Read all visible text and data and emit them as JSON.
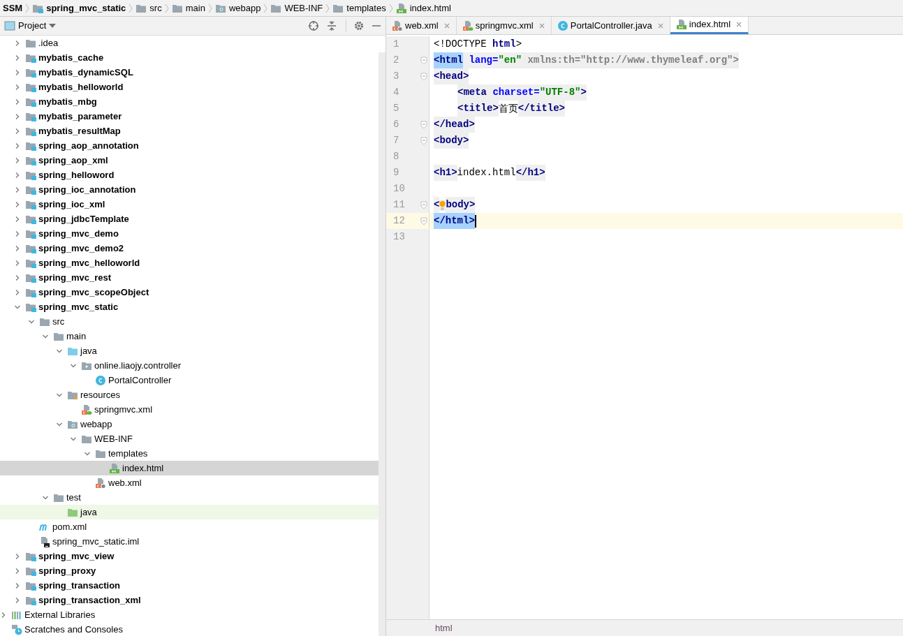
{
  "breadcrumbs": [
    {
      "label": "SSM",
      "kind": "project"
    },
    {
      "label": "spring_mvc_static",
      "kind": "module"
    },
    {
      "label": "src",
      "kind": "folder"
    },
    {
      "label": "main",
      "kind": "folder"
    },
    {
      "label": "webapp",
      "kind": "web-folder"
    },
    {
      "label": "WEB-INF",
      "kind": "folder"
    },
    {
      "label": "templates",
      "kind": "folder"
    },
    {
      "label": "index.html",
      "kind": "html"
    }
  ],
  "project_panel": {
    "title": "Project"
  },
  "tree": [
    {
      "label": ".idea",
      "kind": "folder",
      "expanded": false,
      "selected": false
    },
    {
      "label": "mybatis_cache",
      "kind": "module",
      "expanded": false,
      "selected": false
    },
    {
      "label": "mybatis_dynamicSQL",
      "kind": "module",
      "expanded": false,
      "selected": false
    },
    {
      "label": "mybatis_helloworld",
      "kind": "module",
      "expanded": false,
      "selected": false
    },
    {
      "label": "mybatis_mbg",
      "kind": "module",
      "expanded": false,
      "selected": false
    },
    {
      "label": "mybatis_parameter",
      "kind": "module",
      "expanded": false,
      "selected": false
    },
    {
      "label": "mybatis_resultMap",
      "kind": "module",
      "expanded": false,
      "selected": false
    },
    {
      "label": "spring_aop_annotation",
      "kind": "module",
      "expanded": false,
      "selected": false
    },
    {
      "label": "spring_aop_xml",
      "kind": "module",
      "expanded": false,
      "selected": false
    },
    {
      "label": "spring_helloword",
      "kind": "module",
      "expanded": false,
      "selected": false
    },
    {
      "label": "spring_ioc_annotation",
      "kind": "module",
      "expanded": false,
      "selected": false
    },
    {
      "label": "spring_ioc_xml",
      "kind": "module",
      "expanded": false,
      "selected": false
    },
    {
      "label": "spring_jdbcTemplate",
      "kind": "module",
      "expanded": false,
      "selected": false
    },
    {
      "label": "spring_mvc_demo",
      "kind": "module",
      "expanded": false,
      "selected": false
    },
    {
      "label": "spring_mvc_demo2",
      "kind": "module",
      "expanded": false,
      "selected": false
    },
    {
      "label": "spring_mvc_helloworld",
      "kind": "module",
      "expanded": false,
      "selected": false
    },
    {
      "label": "spring_mvc_rest",
      "kind": "module",
      "expanded": false,
      "selected": false
    },
    {
      "label": "spring_mvc_scopeObject",
      "kind": "module",
      "expanded": false,
      "selected": false
    },
    {
      "label": "spring_mvc_static",
      "kind": "module",
      "expanded": true,
      "selected": false,
      "children": [
        {
          "label": "src",
          "kind": "folder",
          "expanded": true,
          "selected": false,
          "children": [
            {
              "label": "main",
              "kind": "folder",
              "expanded": true,
              "selected": false,
              "children": [
                {
                  "label": "java",
                  "kind": "source-folder",
                  "expanded": true,
                  "selected": false,
                  "children": [
                    {
                      "label": "online.liaojy.controller",
                      "kind": "package",
                      "expanded": true,
                      "selected": false,
                      "children": [
                        {
                          "label": "PortalController",
                          "kind": "class",
                          "selected": false
                        }
                      ]
                    }
                  ]
                },
                {
                  "label": "resources",
                  "kind": "resources-folder",
                  "expanded": true,
                  "selected": false,
                  "children": [
                    {
                      "label": "springmvc.xml",
                      "kind": "spring-xml",
                      "selected": false
                    }
                  ]
                },
                {
                  "label": "webapp",
                  "kind": "web-folder",
                  "expanded": true,
                  "selected": false,
                  "children": [
                    {
                      "label": "WEB-INF",
                      "kind": "folder",
                      "expanded": true,
                      "selected": false,
                      "children": [
                        {
                          "label": "templates",
                          "kind": "folder",
                          "expanded": true,
                          "selected": false,
                          "children": [
                            {
                              "label": "index.html",
                              "kind": "html",
                              "selected": true
                            }
                          ]
                        },
                        {
                          "label": "web.xml",
                          "kind": "web-xml",
                          "selected": false
                        }
                      ]
                    }
                  ]
                }
              ]
            },
            {
              "label": "test",
              "kind": "folder",
              "expanded": true,
              "selected": false,
              "children": [
                {
                  "label": "java",
                  "kind": "test-folder",
                  "selected": false
                }
              ]
            }
          ]
        },
        {
          "label": "pom.xml",
          "kind": "maven",
          "selected": false
        },
        {
          "label": "spring_mvc_static.iml",
          "kind": "iml",
          "selected": false
        }
      ]
    },
    {
      "label": "spring_mvc_view",
      "kind": "module",
      "expanded": false,
      "selected": false
    },
    {
      "label": "spring_proxy",
      "kind": "module",
      "expanded": false,
      "selected": false
    },
    {
      "label": "spring_transaction",
      "kind": "module",
      "expanded": false,
      "selected": false
    },
    {
      "label": "spring_transaction_xml",
      "kind": "module",
      "expanded": false,
      "selected": false
    }
  ],
  "root_items": [
    {
      "label": "External Libraries",
      "kind": "libraries",
      "expanded": false,
      "selected": false
    },
    {
      "label": "Scratches and Consoles",
      "kind": "scratches",
      "selected": false
    }
  ],
  "tabs": [
    {
      "label": "web.xml",
      "kind": "web-xml",
      "selected": false
    },
    {
      "label": "springmvc.xml",
      "kind": "spring-xml",
      "selected": false
    },
    {
      "label": "PortalController.java",
      "kind": "class",
      "selected": false
    },
    {
      "label": "index.html",
      "kind": "html",
      "selected": true
    }
  ],
  "code_lines": [
    {
      "number": "1",
      "fold": false,
      "current": false,
      "tokens": [
        {
          "text": "<!DOCTYPE ",
          "kind": "plain"
        },
        {
          "text": "html",
          "kind": "keyword"
        },
        {
          "text": ">",
          "kind": "plain"
        }
      ]
    },
    {
      "number": "2",
      "fold": true,
      "current": false,
      "tokens": [
        {
          "text": "<html",
          "kind": "tag",
          "matched": true
        },
        {
          "text": "lang=",
          "kind": "attr"
        },
        {
          "text": "\"en\"",
          "kind": "value"
        },
        {
          "text": " xmlns:th=\"http://www.thymeleaf.org\">",
          "kind": "muted"
        }
      ]
    },
    {
      "number": "3",
      "fold": true,
      "current": false,
      "tokens": [
        {
          "text": "<head>",
          "kind": "tag"
        }
      ]
    },
    {
      "number": "4",
      "fold": false,
      "current": false,
      "indented": true,
      "tokens": [
        {
          "text": "<meta",
          "kind": "tag"
        },
        {
          "text": "charset=",
          "kind": "attr"
        },
        {
          "text": "\"UTF-8\"",
          "kind": "value"
        },
        {
          "text": ">",
          "kind": "tag"
        }
      ]
    },
    {
      "number": "5",
      "fold": false,
      "current": false,
      "indented": true,
      "tokens": [
        {
          "text": "<title>",
          "kind": "tag"
        },
        {
          "text": "首页",
          "kind": "cjk"
        },
        {
          "text": "</title>",
          "kind": "tag"
        }
      ]
    },
    {
      "number": "6",
      "fold": true,
      "current": false,
      "tokens": [
        {
          "text": "</head>",
          "kind": "tag"
        }
      ]
    },
    {
      "number": "7",
      "fold": true,
      "current": false,
      "tokens": [
        {
          "text": "<body>",
          "kind": "tag"
        }
      ]
    },
    {
      "number": "8",
      "fold": false,
      "current": false
    },
    {
      "number": "9",
      "fold": false,
      "current": false,
      "tokens": [
        {
          "text": "<h1>",
          "kind": "tag"
        },
        {
          "text": "index.html",
          "kind": "plain"
        },
        {
          "text": "</h1>",
          "kind": "tag"
        }
      ]
    },
    {
      "number": "10",
      "fold": false,
      "current": false
    },
    {
      "number": "11",
      "fold": true,
      "current": false,
      "bulb": true,
      "tokens": [
        {
          "text": "<",
          "kind": "tag"
        },
        {
          "text": "body>",
          "kind": "tag"
        }
      ]
    },
    {
      "number": "12",
      "fold": true,
      "current": true,
      "tokens": [
        {
          "text": "</html>",
          "kind": "tag",
          "matched": true
        }
      ]
    },
    {
      "number": "13",
      "fold": false,
      "current": false
    }
  ],
  "status_bar": {
    "breadcrumb": "html"
  }
}
